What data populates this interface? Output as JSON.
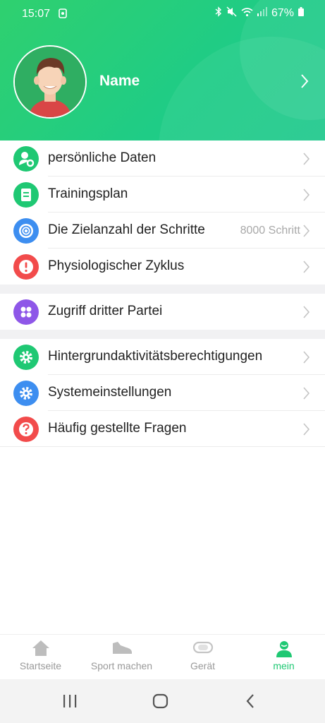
{
  "status": {
    "time": "15:07",
    "battery": "67%"
  },
  "profile": {
    "name": "Name"
  },
  "menu": {
    "group1": [
      {
        "label": "persönliche Daten",
        "icon": "user-gear-icon",
        "color": "#1fc873"
      },
      {
        "label": "Trainingsplan",
        "icon": "notebook-icon",
        "color": "#1fc873"
      },
      {
        "label": "Die Zielanzahl der Schritte",
        "value": "8000 Schritt",
        "icon": "target-icon",
        "color": "#3d8ef0"
      },
      {
        "label": "Physiologischer Zyklus",
        "icon": "alert-icon",
        "color": "#f24b4b"
      }
    ],
    "group2": [
      {
        "label": "Zugriff dritter Partei",
        "icon": "apps-icon",
        "color": "#8e57e8"
      }
    ],
    "group3": [
      {
        "label": "Hintergrundaktivitätsberechtigungen",
        "icon": "gear-icon",
        "color": "#1fc873"
      },
      {
        "label": "Systemeinstellungen",
        "icon": "settings-icon",
        "color": "#3d8ef0"
      },
      {
        "label": "Häufig gestellte Fragen",
        "icon": "question-icon",
        "color": "#f24b4b"
      }
    ]
  },
  "tabs": [
    {
      "label": "Startseite",
      "icon": "home-icon"
    },
    {
      "label": "Sport machen",
      "icon": "sneaker-icon"
    },
    {
      "label": "Gerät",
      "icon": "band-icon"
    },
    {
      "label": "mein",
      "icon": "profile-icon",
      "active": true
    }
  ],
  "colors": {
    "accent": "#1fc873",
    "header": "#22cc7c"
  }
}
